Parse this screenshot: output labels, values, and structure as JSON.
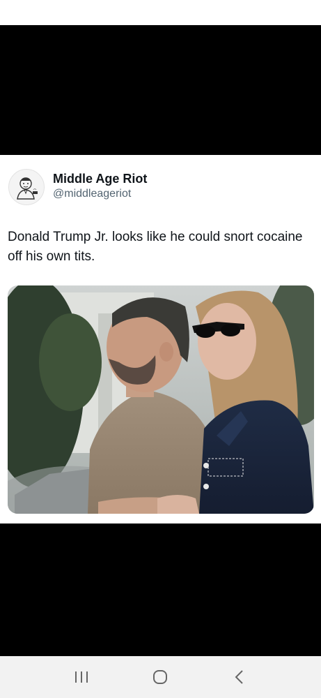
{
  "tweet": {
    "display_name": "Middle Age Riot",
    "handle": "@middleageriot",
    "text": "Donald Trump Jr. looks like he could snort cocaine off his own tits."
  },
  "icons": {
    "avatar": "retro-man-avatar-icon",
    "nav_recents": "recent-apps-icon",
    "nav_home": "home-icon",
    "nav_back": "back-icon"
  },
  "colors": {
    "name": "#0f1419",
    "handle": "#536471",
    "navbar": "#f2f2f2"
  }
}
